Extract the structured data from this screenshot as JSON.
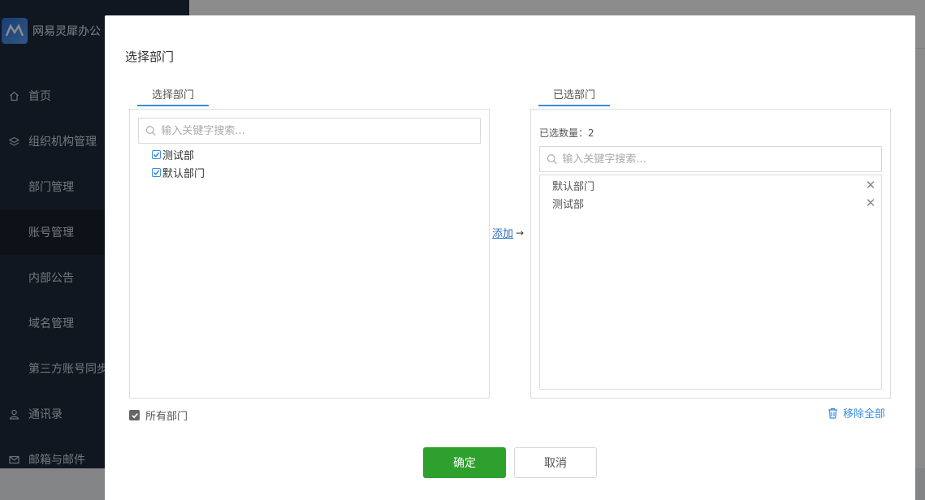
{
  "app": {
    "brand_name": "网易灵犀办公",
    "nav": [
      {
        "label": "首页",
        "icon": "home-icon"
      },
      {
        "label": "组织机构管理",
        "icon": "layers-icon"
      },
      {
        "label": "部门管理"
      },
      {
        "label": "账号管理"
      },
      {
        "label": "内部公告"
      },
      {
        "label": "域名管理"
      },
      {
        "label": "第三方账号同步"
      },
      {
        "label": "通讯录",
        "icon": "user-icon"
      },
      {
        "label": "邮箱与邮件",
        "icon": "mail-icon"
      }
    ]
  },
  "modal": {
    "title": "选择部门",
    "left_tab": "选择部门",
    "right_tab": "已选部门",
    "left_search_placeholder": "输入关键字搜索...",
    "right_search_placeholder": "输入关键字搜索...",
    "tree": [
      {
        "label": "测试部",
        "checked": true
      },
      {
        "label": "默认部门",
        "checked": true
      }
    ],
    "add_label": "添加",
    "add_arrow": "→",
    "selected_count_label": "已选数量：2",
    "selected": [
      {
        "label": "默认部门"
      },
      {
        "label": "测试部"
      }
    ],
    "remove_icon": "✕",
    "all_depts_label": "所有部门",
    "remove_all_label": "移除全部",
    "ok_label": "确定",
    "cancel_label": "取消"
  },
  "colors": {
    "accent": "#3a8dde",
    "primary_button": "#2ea02e",
    "sidebar_bg": "#1f2a3c"
  }
}
